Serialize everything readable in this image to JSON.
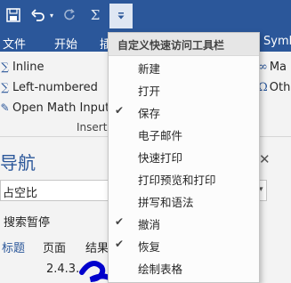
{
  "colors": {
    "accent": "#2b579a",
    "ribbon_bg": "#f3f3f3",
    "menu_bg": "#fcfcfc"
  },
  "quick_access": {
    "icons": [
      "save-icon",
      "undo-icon",
      "redo-icon",
      "sigma-icon",
      "customize-dropdown-icon"
    ],
    "sigma_glyph": "Σ"
  },
  "tabs": [
    "文件",
    "开始",
    "插",
    "Symb"
  ],
  "ribbon": {
    "equation_forms": [
      {
        "label": "Inline",
        "icon": "inline-equation-icon"
      },
      {
        "label": "Left-numbered",
        "icon": "left-numbered-icon"
      },
      {
        "label": "Open Math Input P",
        "icon": "math-input-icon"
      }
    ],
    "insert_group_label": "Insert",
    "right_items": [
      "Ma",
      "Oth"
    ]
  },
  "nav_pane": {
    "title": "导航",
    "search_value": "占空比",
    "search_status": "搜索暂停",
    "tabs": [
      "标题",
      "页面",
      "结果"
    ],
    "heading_item": "2.4.3."
  },
  "dropdown": {
    "title": "自定义快速访问工具栏",
    "items": [
      {
        "label": "新建",
        "checked": false
      },
      {
        "label": "打开",
        "checked": false
      },
      {
        "label": "保存",
        "checked": true
      },
      {
        "label": "电子邮件",
        "checked": false
      },
      {
        "label": "快速打印",
        "checked": false
      },
      {
        "label": "打印预览和打印",
        "checked": false
      },
      {
        "label": "拼写和语法",
        "checked": false
      },
      {
        "label": "撤消",
        "checked": true
      },
      {
        "label": "恢复",
        "checked": true
      },
      {
        "label": "绘制表格",
        "checked": false
      }
    ]
  }
}
